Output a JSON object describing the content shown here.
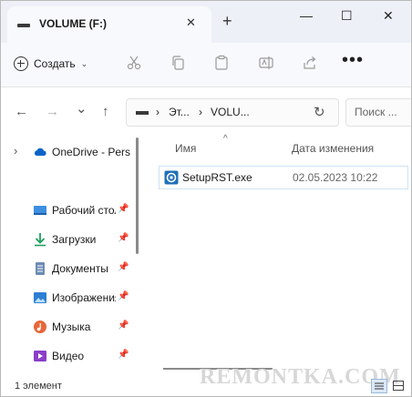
{
  "window": {
    "tab_title": "VOLUME (F:)",
    "tab_close": "✕",
    "new_tab": "+",
    "controls": {
      "minimize": "—",
      "maximize": "☐",
      "close": "✕"
    }
  },
  "toolbar": {
    "create_label": "Создать",
    "more": "•••",
    "icons": [
      "cut-icon",
      "copy-icon",
      "paste-icon",
      "rename-icon",
      "share-icon"
    ]
  },
  "nav": {
    "back": "←",
    "forward": "→",
    "recent": "⌄",
    "up": "↑",
    "breadcrumbs": [
      "Эт...",
      "VOLU..."
    ],
    "separator": "›",
    "refresh": "↻",
    "search_placeholder": "Поиск ..."
  },
  "sidebar": {
    "onedrive": {
      "label": "OneDrive - Perso",
      "expander": "›"
    },
    "items": [
      {
        "label": "Рабочий стол",
        "icon": "desktop-icon",
        "pin": "📌"
      },
      {
        "label": "Загрузки",
        "icon": "downloads-icon",
        "pin": "📌"
      },
      {
        "label": "Документы",
        "icon": "documents-icon",
        "pin": "📌"
      },
      {
        "label": "Изображения",
        "icon": "pictures-icon",
        "pin": "📌"
      },
      {
        "label": "Музыка",
        "icon": "music-icon",
        "pin": "📌"
      },
      {
        "label": "Видео",
        "icon": "video-icon",
        "pin": "📌"
      }
    ]
  },
  "file_list": {
    "sort_caret": "^",
    "columns": {
      "name": "Имя",
      "date": "Дата изменения"
    },
    "rows": [
      {
        "name": "SetupRST.exe",
        "date": "02.05.2023 10:22",
        "icon": "setup-exe-icon"
      }
    ]
  },
  "status_bar": {
    "count": "1 элемент"
  },
  "watermark": "REMONTKA.COM",
  "colors": {
    "accent": "#0a64c8",
    "title_bg": "#eef0f7",
    "selection_border": "#cde3f7"
  }
}
